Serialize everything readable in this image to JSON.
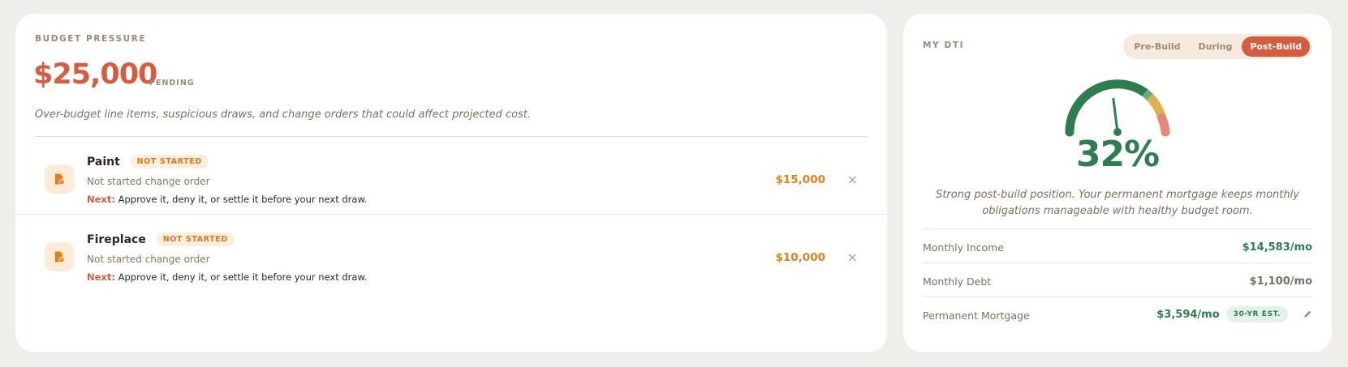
{
  "budget": {
    "eyebrow": "BUDGET PRESSURE",
    "amount": "$25,000",
    "amount_status": "PENDING",
    "description": "Over-budget line items, suspicious draws, and change orders that could affect projected cost.",
    "items": [
      {
        "icon": "document-clock-icon",
        "title": "Paint",
        "status": "NOT STARTED",
        "subtitle": "Not started change order",
        "next_label": "Next:",
        "next_text": " Approve it, deny it, or settle it before your next draw.",
        "amount": "$15,000",
        "close": "×"
      },
      {
        "icon": "document-clock-icon",
        "title": "Fireplace",
        "status": "NOT STARTED",
        "subtitle": "Not started change order",
        "next_label": "Next:",
        "next_text": " Approve it, deny it, or settle it before your next draw.",
        "amount": "$10,000",
        "close": "×"
      }
    ]
  },
  "dti": {
    "eyebrow": "MY DTI",
    "tabs": [
      "Pre-Build",
      "During",
      "Post-Build"
    ],
    "active_tab": "Post-Build",
    "gauge_percent": 32,
    "value": "32%",
    "description": "Strong post-build position. Your permanent mortgage keeps monthly obligations manageable with healthy budget room.",
    "metrics": {
      "income_label": "Monthly Income",
      "income_value": "$14,583/mo",
      "debt_label": "Monthly Debt",
      "debt_value": "$1,100/mo",
      "mortgage_label": "Permanent Mortgage",
      "mortgage_value": "$3,594/mo",
      "mortgage_badge": "30-YR EST."
    }
  },
  "colors": {
    "accent": "#d45d3f",
    "amount_orange": "#e0811d",
    "good_green": "#2e7d50",
    "gauge_yellow": "#dbb54a",
    "gauge_red": "#e58876",
    "background": "#efeeeb"
  }
}
